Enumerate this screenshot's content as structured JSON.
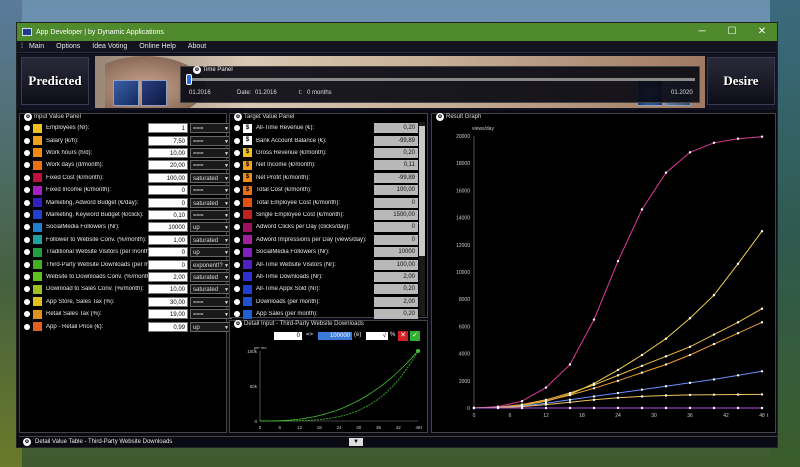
{
  "window": {
    "title": "App Developer | by Dynamic Applications",
    "min": "─",
    "max": "☐",
    "close": "✕"
  },
  "menu": {
    "grip": "⁞",
    "items": [
      "Main",
      "Options",
      "Idea Voting",
      "Online Help",
      "About"
    ]
  },
  "banner": {
    "left": "Predicted",
    "right": "Desire"
  },
  "time_panel": {
    "title": "Time Panel",
    "start": "01.2016",
    "date_label": "Date:",
    "date_value": "01.2016",
    "t_label": "t:",
    "t_value": "0  months",
    "end": "01.2020"
  },
  "input_panel": {
    "title": "Input Value Panel",
    "rows": [
      {
        "label": "Employees (Nr):",
        "value": "1",
        "mode": "===",
        "color": "#f0c020",
        "icon": "👤"
      },
      {
        "label": "Salary (€/h):",
        "value": "7,50",
        "mode": "===",
        "color": "#f0a020",
        "icon": "€"
      },
      {
        "label": "Work hours (h/d):",
        "value": "10,00",
        "mode": "===",
        "color": "#f08a10",
        "icon": "⏱"
      },
      {
        "label": "Work days (d/month):",
        "value": "20,00",
        "mode": "===",
        "color": "#e87010",
        "icon": "📅"
      },
      {
        "label": "Fixed Cost (€/month):",
        "value": "100,00",
        "mode": "saturated",
        "color": "#c01040",
        "icon": ""
      },
      {
        "label": "Fixed Income (€/month):",
        "value": "0",
        "mode": "===",
        "color": "#a020c0",
        "icon": ""
      },
      {
        "label": "Marketing, Adword Budget (€/day):",
        "value": "0",
        "mode": "saturated",
        "color": "#3020c0",
        "icon": ""
      },
      {
        "label": "Marketing, Keyword Budget (€/click):",
        "value": "0,10",
        "mode": "===",
        "color": "#2040d0",
        "icon": ""
      },
      {
        "label": "SocialMedia Followers (Nr):",
        "value": "10000",
        "mode": "up",
        "color": "#2080d0",
        "icon": "👥"
      },
      {
        "label": "Follower to Website Conv. (%/month):",
        "value": "1,00",
        "mode": "saturated",
        "color": "#20a0a0",
        "icon": ""
      },
      {
        "label": "Traditional Website Visitors (per month):",
        "value": "0",
        "mode": "up",
        "color": "#20a040",
        "icon": ""
      },
      {
        "label": "Third-Party Website Downloads (per month):",
        "value": "0",
        "mode": "exponent!?",
        "color": "#40b020",
        "icon": ""
      },
      {
        "label": "Website to Downloads Conv. (%/month):",
        "value": "2,00",
        "mode": "saturated",
        "color": "#60c020",
        "icon": ""
      },
      {
        "label": "Download to Sales Conv. (%/month):",
        "value": "10,00",
        "mode": "saturated",
        "color": "#a0c020",
        "icon": ""
      },
      {
        "label": "App Store, Sales Tax (%):",
        "value": "30,00",
        "mode": "===",
        "color": "#e0c020",
        "icon": ""
      },
      {
        "label": "Retail Sales Tax (%):",
        "value": "19,00",
        "mode": "===",
        "color": "#e09020",
        "icon": ""
      },
      {
        "label": "App - Retail Price (€):",
        "value": "0,99",
        "mode": "up",
        "color": "#e06020",
        "icon": ""
      }
    ]
  },
  "target_panel": {
    "title": "Target Value Panel",
    "rows": [
      {
        "label": "All-Time Revenue (€):",
        "value": "0,20",
        "color": "#ffffff",
        "icon": "$"
      },
      {
        "label": "Bank Account Balance (€):",
        "value": "-99,89",
        "color": "#ffffff",
        "icon": "$"
      },
      {
        "label": "Gross Revenue (€/month):",
        "value": "0,20",
        "color": "#f0c020",
        "icon": "$"
      },
      {
        "label": "Net Income (€/month):",
        "value": "0,11",
        "color": "#f0a020",
        "icon": "$"
      },
      {
        "label": "Net Profit (€/month):",
        "value": "-99,89",
        "color": "#f08a10",
        "icon": "$"
      },
      {
        "label": "Total Cost (€/month):",
        "value": "100,00",
        "color": "#e87010",
        "icon": "$"
      },
      {
        "label": "Total Employee Cost (€/month):",
        "value": "0",
        "color": "#e05010",
        "icon": ""
      },
      {
        "label": "Single Employee Cost (€/month):",
        "value": "1500,00",
        "color": "#c02020",
        "icon": ""
      },
      {
        "label": "Adword Clicks per Day (clicks/day):",
        "value": "0",
        "color": "#a01060",
        "icon": ""
      },
      {
        "label": "Adword Impressions per Day (views/day):",
        "value": "0",
        "color": "#a020a0",
        "icon": ""
      },
      {
        "label": "SocialMedia Followers (Nr):",
        "value": "10000",
        "color": "#8020c0",
        "icon": ""
      },
      {
        "label": "All-Time Website Visitors (Nr):",
        "value": "100,00",
        "color": "#5020c0",
        "icon": ""
      },
      {
        "label": "All-Time Downloads (Nr):",
        "value": "2,00",
        "color": "#3030d0",
        "icon": ""
      },
      {
        "label": "All-Time Appx Sold (Nr):",
        "value": "0,20",
        "color": "#2040d0",
        "icon": ""
      },
      {
        "label": "Downloads (per month):",
        "value": "2,00",
        "color": "#2050d0",
        "icon": ""
      },
      {
        "label": "App Sales (per month):",
        "value": "0,20",
        "color": "#2060d0",
        "icon": ""
      }
    ]
  },
  "detail": {
    "title": "Detail Input - Third-Party Website Downloads",
    "from": "0",
    "arrow": "=>",
    "to": "100000",
    "op": "(e)",
    "pct": "√",
    "pct_sign": "%",
    "y_unit": "per mo",
    "yticks": [
      "100k",
      "50k",
      "0"
    ],
    "xticks": [
      "0",
      "6",
      "12",
      "18",
      "24",
      "30",
      "36",
      "42",
      "48"
    ],
    "t_label": "t"
  },
  "result": {
    "title": "Result Graph",
    "y_unit": "views/day",
    "t_label": "t"
  },
  "bottom": {
    "title": "Detail Value Table - Third-Party Website Downloads",
    "chev": "▼"
  },
  "chart_data": {
    "type": "line",
    "title": "",
    "xlabel": "t",
    "ylabel": "views/day",
    "xlim": [
      0,
      48
    ],
    "ylim": [
      0,
      20000
    ],
    "yticks": [
      0,
      2000,
      4000,
      6000,
      8000,
      10000,
      12000,
      14000,
      16000,
      18000,
      20000
    ],
    "xticks": [
      0,
      6,
      12,
      18,
      24,
      30,
      36,
      42,
      48
    ],
    "x": [
      0,
      4,
      8,
      12,
      16,
      20,
      24,
      28,
      32,
      36,
      40,
      44,
      48
    ],
    "series": [
      {
        "color": "#e03a9a",
        "values": [
          0,
          100,
          500,
          1500,
          3200,
          6500,
          10800,
          14600,
          17300,
          18800,
          19500,
          19800,
          19950
        ]
      },
      {
        "color": "#f0d050",
        "values": [
          0,
          50,
          200,
          500,
          1000,
          1800,
          2800,
          3900,
          5100,
          6600,
          8300,
          10600,
          13000
        ]
      },
      {
        "color": "#f0c040",
        "values": [
          0,
          60,
          250,
          600,
          1100,
          1700,
          2400,
          3100,
          3800,
          4500,
          5400,
          6300,
          7300
        ]
      },
      {
        "color": "#f0a030",
        "values": [
          0,
          50,
          220,
          520,
          950,
          1450,
          2000,
          2600,
          3200,
          3900,
          4700,
          5500,
          6300
        ]
      },
      {
        "color": "#6a90ff",
        "values": [
          0,
          40,
          150,
          350,
          600,
          850,
          1100,
          1350,
          1600,
          1850,
          2100,
          2400,
          2700
        ]
      },
      {
        "color": "#f0c060",
        "values": [
          0,
          30,
          100,
          250,
          420,
          600,
          750,
          850,
          920,
          960,
          980,
          990,
          1000
        ]
      },
      {
        "color": "#b050e0",
        "values": [
          0,
          0,
          0,
          0,
          0,
          0,
          0,
          0,
          0,
          0,
          0,
          0,
          0
        ]
      }
    ]
  }
}
